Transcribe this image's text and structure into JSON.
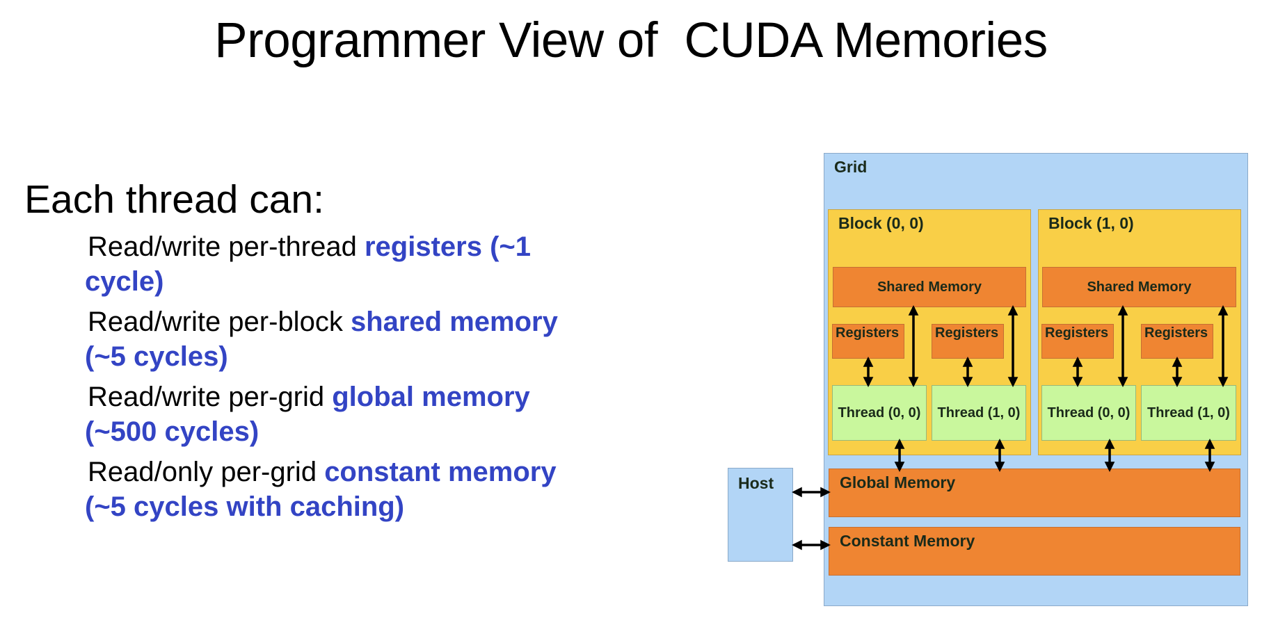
{
  "slide": {
    "title": "Programmer View of  CUDA Memories",
    "heading": "Each thread can:",
    "bullets": [
      {
        "lead": "Read/write per-thread ",
        "highlight": "registers (~1",
        "continuation": "cycle)"
      },
      {
        "lead": "Read/write per-block ",
        "highlight": "shared memory",
        "continuation": "(~5 cycles)"
      },
      {
        "lead": "Read/write per-grid ",
        "highlight": "global memory",
        "continuation": "(~500 cycles)"
      },
      {
        "lead": "Read/only per-grid ",
        "highlight": "constant memory",
        "continuation": "(~5 cycles with caching)"
      }
    ],
    "highlight_color": "#3344c4"
  },
  "diagram": {
    "grid_label": "Grid",
    "host_label": "Host",
    "blocks": [
      {
        "label": "Block (0, 0)",
        "shared_memory_label": "Shared Memory",
        "threads": [
          {
            "registers_label": "Registers",
            "thread_label": "Thread (0, 0)"
          },
          {
            "registers_label": "Registers",
            "thread_label": "Thread (1, 0)"
          }
        ]
      },
      {
        "label": "Block (1, 0)",
        "shared_memory_label": "Shared Memory",
        "threads": [
          {
            "registers_label": "Registers",
            "thread_label": "Thread (0, 0)"
          },
          {
            "registers_label": "Registers",
            "thread_label": "Thread (1, 0)"
          }
        ]
      }
    ],
    "global_memory_label": "Global Memory",
    "constant_memory_label": "Constant Memory",
    "colors": {
      "grid": "#b2d5f6",
      "block": "#f9cf47",
      "memory": "#ef8532",
      "thread": "#c9f79d",
      "highlight": "#3344c4"
    }
  }
}
